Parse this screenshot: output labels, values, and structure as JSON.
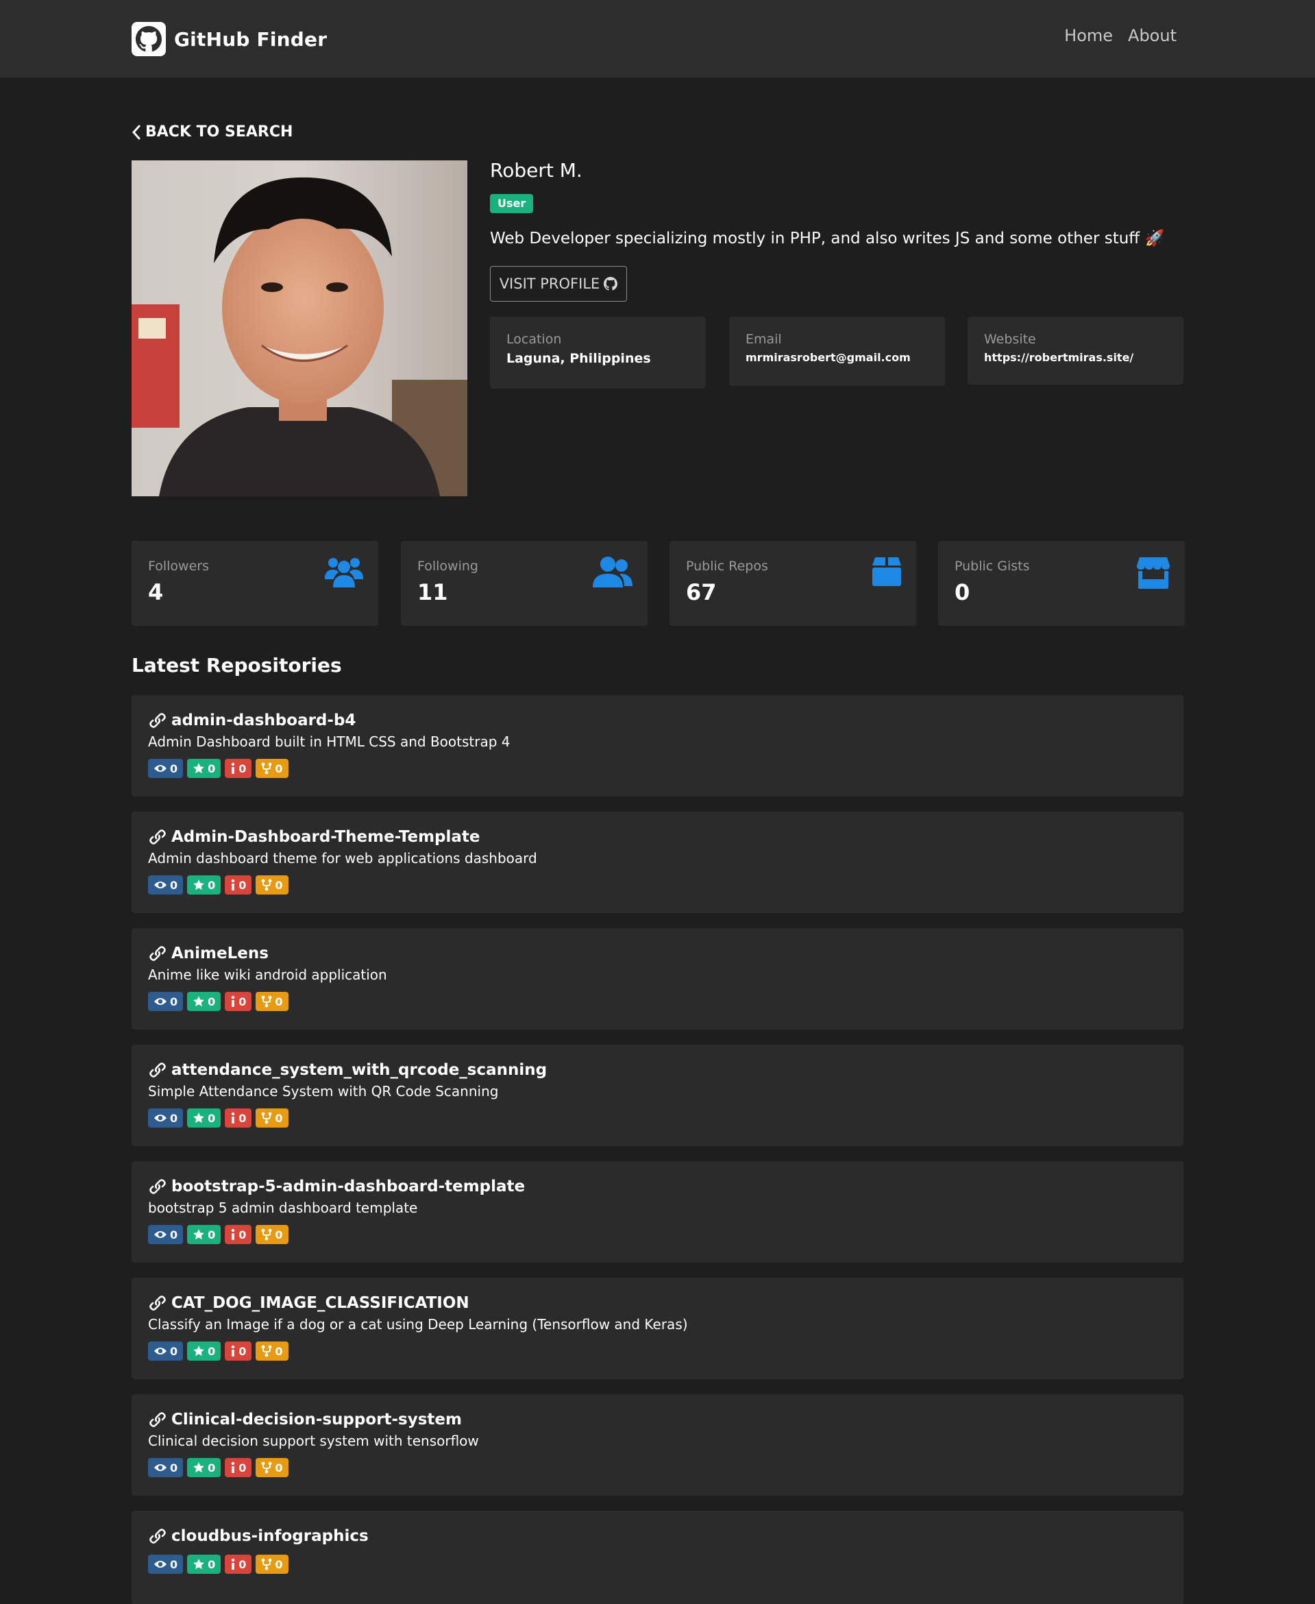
{
  "navbar": {
    "brand": "GitHub Finder",
    "links": [
      "Home",
      "About"
    ]
  },
  "back_label": "BACK TO SEARCH",
  "profile": {
    "name": "Robert M.",
    "type_badge": "User",
    "bio": "Web Developer specializing mostly in PHP, and also writes JS and some other stuff 🚀",
    "visit_label": "VISIT PROFILE",
    "info": [
      {
        "label": "Location",
        "value": "Laguna, Philippines"
      },
      {
        "label": "Email",
        "value": "mrmirasrobert@gmail.com"
      },
      {
        "label": "Website",
        "value": "https://robertmiras.site/"
      }
    ]
  },
  "stats": [
    {
      "label": "Followers",
      "value": "4",
      "icon": "users-icon"
    },
    {
      "label": "Following",
      "value": "11",
      "icon": "user-friends-icon"
    },
    {
      "label": "Public Repos",
      "value": "67",
      "icon": "box-icon"
    },
    {
      "label": "Public Gists",
      "value": "0",
      "icon": "store-icon"
    }
  ],
  "repos_title": "Latest Repositories",
  "repos": [
    {
      "name": "admin-dashboard-b4",
      "description": "Admin Dashboard built in HTML CSS and Bootstrap 4",
      "watchers": "0",
      "stars": "0",
      "issues": "0",
      "forks": "0"
    },
    {
      "name": "Admin-Dashboard-Theme-Template",
      "description": "Admin dashboard theme for web applications dashboard",
      "watchers": "0",
      "stars": "0",
      "issues": "0",
      "forks": "0"
    },
    {
      "name": "AnimeLens",
      "description": "Anime like wiki android application",
      "watchers": "0",
      "stars": "0",
      "issues": "0",
      "forks": "0"
    },
    {
      "name": "attendance_system_with_qrcode_scanning",
      "description": "Simple Attendance System with QR Code Scanning",
      "watchers": "0",
      "stars": "0",
      "issues": "0",
      "forks": "0"
    },
    {
      "name": "bootstrap-5-admin-dashboard-template",
      "description": "bootstrap 5 admin dashboard template",
      "watchers": "0",
      "stars": "0",
      "issues": "0",
      "forks": "0"
    },
    {
      "name": "CAT_DOG_IMAGE_CLASSIFICATION",
      "description": "Classify an Image if a dog or a cat using Deep Learning (Tensorflow and Keras)",
      "watchers": "0",
      "stars": "0",
      "issues": "0",
      "forks": "0"
    },
    {
      "name": "Clinical-decision-support-system",
      "description": "Clinical decision support system with tensorflow",
      "watchers": "0",
      "stars": "0",
      "issues": "0",
      "forks": "0"
    },
    {
      "name": "cloudbus-infographics",
      "description": "",
      "watchers": "0",
      "stars": "0",
      "issues": "0",
      "forks": "0"
    }
  ],
  "colors": {
    "background": "#1e1e1e",
    "card": "#2b2b2b",
    "navbar": "#2d2d2d",
    "accent_blue": "#1e88e5",
    "badge_green": "#19b27e",
    "badge_red": "#d9453a",
    "badge_orange": "#e89b11",
    "badge_blue": "#2f5c8f"
  }
}
